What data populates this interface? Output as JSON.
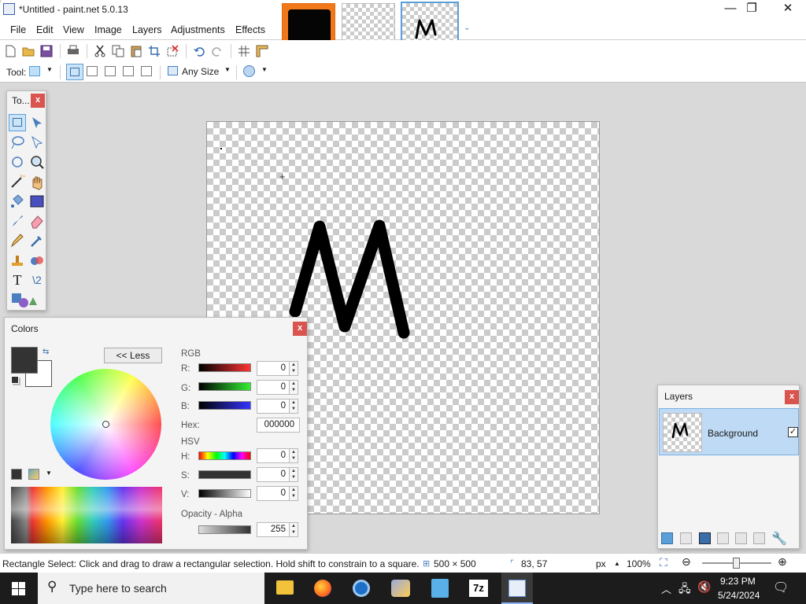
{
  "window": {
    "title": "*Untitled - paint.net 5.0.13"
  },
  "menu": [
    "File",
    "Edit",
    "View",
    "Image",
    "Layers",
    "Adjustments",
    "Effects"
  ],
  "toolbar": {
    "tool_label": "Tool:",
    "size_mode": "Any Size"
  },
  "tools_panel": {
    "title": "To..."
  },
  "colors_panel": {
    "title": "Colors",
    "less_button": "<< Less",
    "rgb_label": "RGB",
    "r_label": "R:",
    "g_label": "G:",
    "b_label": "B:",
    "r": "0",
    "g": "0",
    "b": "0",
    "hex_label": "Hex:",
    "hex": "000000",
    "hsv_label": "HSV",
    "h_label": "H:",
    "s_label": "S:",
    "v_label": "V:",
    "h": "0",
    "s": "0",
    "v": "0",
    "opacity_label": "Opacity - Alpha",
    "alpha": "255",
    "primary_color": "#333333",
    "secondary_color": "#ffffff"
  },
  "layers_panel": {
    "title": "Layers",
    "layer_name": "Background",
    "layer_visible": true
  },
  "status": {
    "hint": "Rectangle Select: Click and drag to draw a rectangular selection. Hold shift to constrain to a square.",
    "image_size": "500 × 500",
    "cursor_pos": "83, 57",
    "unit": "px",
    "zoom": "100%"
  },
  "taskbar": {
    "search_placeholder": "Type here to search",
    "time": "9:23 PM",
    "date": "5/24/2024"
  },
  "canvas_drawing": {
    "letter": "M",
    "stroke_color": "#000000"
  }
}
